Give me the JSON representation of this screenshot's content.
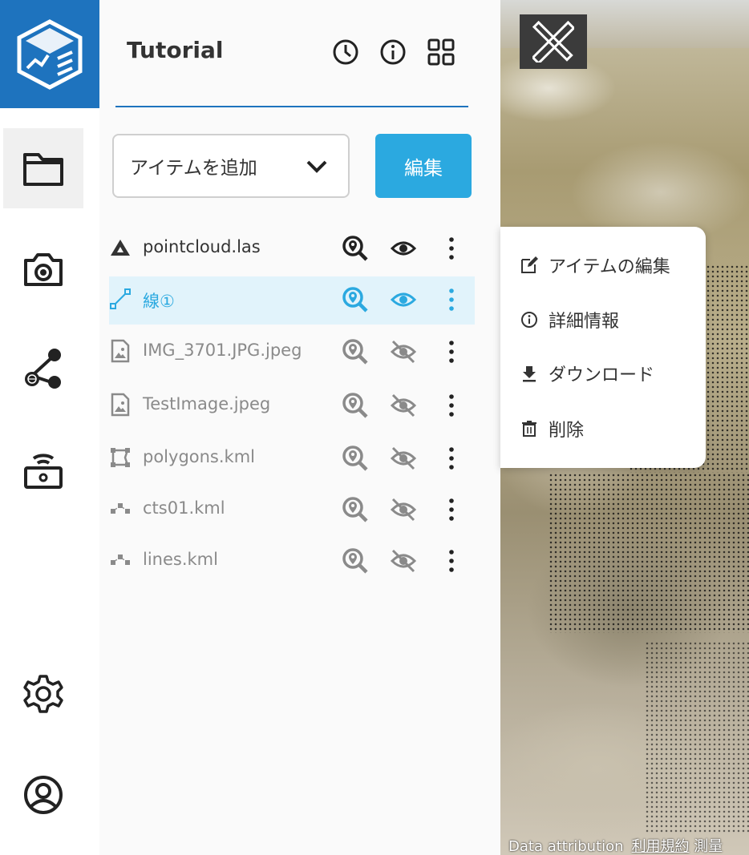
{
  "sidebar": {
    "logo": "app-logo",
    "items": [
      {
        "name": "folder-icon",
        "active": true
      },
      {
        "name": "camera-icon"
      },
      {
        "name": "share-icon"
      },
      {
        "name": "device-icon"
      }
    ],
    "bottom": [
      {
        "name": "gear-icon"
      },
      {
        "name": "user-icon"
      }
    ]
  },
  "panel": {
    "title": "Tutorial",
    "add_item_placeholder": "アイテムを追加",
    "edit_label": "編集",
    "items": [
      {
        "label": "pointcloud.las",
        "icon": "pointcloud-icon",
        "visible": true,
        "selected": false
      },
      {
        "label": "線①",
        "icon": "line-icon",
        "visible": true,
        "selected": true
      },
      {
        "label": "IMG_3701.JPG.jpeg",
        "icon": "image-icon",
        "visible": false,
        "selected": false
      },
      {
        "label": "TestImage.jpeg",
        "icon": "image-icon",
        "visible": false,
        "selected": false
      },
      {
        "label": "polygons.kml",
        "icon": "polygon-icon",
        "visible": false,
        "selected": false
      },
      {
        "label": "cts01.kml",
        "icon": "points-icon",
        "visible": false,
        "selected": false
      },
      {
        "label": "lines.kml",
        "icon": "points-icon",
        "visible": false,
        "selected": false
      }
    ]
  },
  "context_menu": {
    "items": [
      {
        "label": "アイテムの編集",
        "icon": "edit-icon"
      },
      {
        "label": "詳細情報",
        "icon": "info-icon"
      },
      {
        "label": "ダウンロード",
        "icon": "download-icon"
      },
      {
        "label": "削除",
        "icon": "trash-icon"
      }
    ]
  },
  "map": {
    "attribution": "Data attribution",
    "terms": "利用規約",
    "survey": "測量"
  },
  "colors": {
    "accent": "#2ba9e0",
    "brand": "#1e73be"
  }
}
